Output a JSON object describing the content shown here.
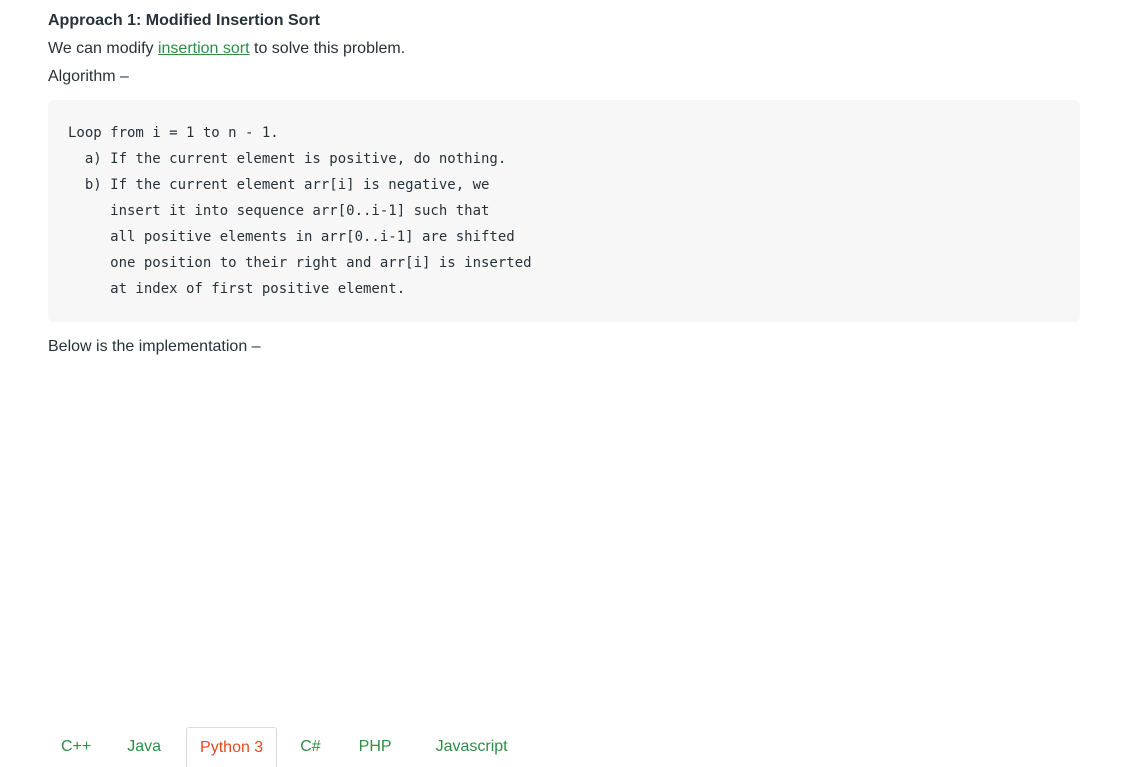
{
  "heading": "Approach 1: Modified Insertion Sort",
  "intro": {
    "before": "We can modify ",
    "link": "insertion sort",
    "after": " to solve this problem."
  },
  "algorithm_label": "Algorithm –",
  "code_lines": [
    "Loop from i = 1 to n - 1.",
    "  a) If the current element is positive, do nothing.",
    "  b) If the current element arr[i] is negative, we",
    "     insert it into sequence arr[0..i-1] such that",
    "     all positive elements in arr[0..i-1] are shifted",
    "     one position to their right and arr[i] is inserted",
    "     at index of first positive element."
  ],
  "implementation_label": "Below is the implementation –",
  "tabs": [
    {
      "label": "C++",
      "active": false
    },
    {
      "label": "Java",
      "active": false
    },
    {
      "label": "Python 3",
      "active": true
    },
    {
      "label": "C#",
      "active": false
    },
    {
      "label": "PHP",
      "active": false
    },
    {
      "label": "Javascript",
      "active": false
    }
  ],
  "colors": {
    "link": "#2f8d46",
    "active_tab": "#e5491f",
    "text": "#273239",
    "code_bg": "#f7f7f7"
  }
}
